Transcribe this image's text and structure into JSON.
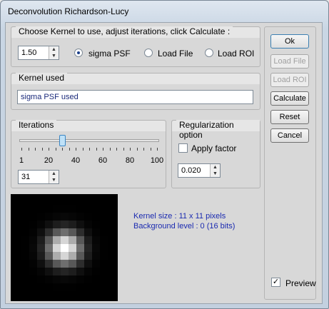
{
  "window": {
    "title": "Deconvolution Richardson-Lucy"
  },
  "kernel_group": {
    "title": "Choose Kernel to use, adjust iterations, click Calculate :",
    "sigma_value": "1.50",
    "options": [
      {
        "label": "sigma PSF",
        "selected": true
      },
      {
        "label": "Load File",
        "selected": false
      },
      {
        "label": "Load ROI",
        "selected": false
      }
    ]
  },
  "kernel_used": {
    "title": "Kernel used",
    "value": "sigma PSF used"
  },
  "iterations": {
    "title": "Iterations",
    "value": "31",
    "slider_fraction": 0.3,
    "ticks": [
      "1",
      "20",
      "40",
      "60",
      "80",
      "100"
    ]
  },
  "regularization": {
    "title": "Regularization option",
    "apply_label": "Apply factor",
    "apply_checked": false,
    "factor_value": "0.020"
  },
  "buttons": {
    "ok": "Ok",
    "load_file": "Load File",
    "load_roi": "Load ROI",
    "calculate": "Calculate",
    "reset": "Reset",
    "cancel": "Cancel"
  },
  "info": {
    "kernel_size": "Kernel size :  11 x 11 pixels",
    "background_level": "Background level :  0 (16 bits)"
  },
  "preview": {
    "label": "Preview",
    "checked": true
  },
  "colors": {
    "info_text": "#1a2ab0",
    "textbox_text": "#1a2a7a",
    "selection": "#1b3f8a"
  }
}
